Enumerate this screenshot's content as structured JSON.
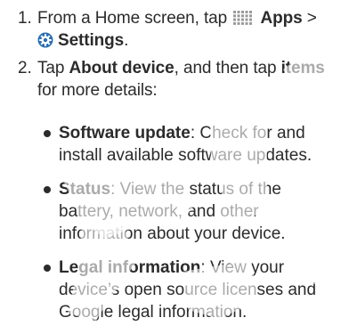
{
  "steps": [
    {
      "number": "1.",
      "line1": {
        "pre": "From a Home screen, tap",
        "bold": "Apps",
        "post": ">"
      },
      "line2": {
        "bold": "Settings",
        "post": "."
      }
    },
    {
      "number": "2.",
      "line1": {
        "pre": "Tap ",
        "bold1": "About device",
        "mid": ", and then tap ",
        "bold2": "items"
      },
      "line2": "for more details:"
    }
  ],
  "bullets": [
    {
      "title": "Software update",
      "lines": [
        ": Check for and",
        "install available software updates."
      ]
    },
    {
      "title": "Status",
      "lines": [
        ": View the status of the",
        "battery, network, and other",
        "information about your device."
      ]
    },
    {
      "title": "Legal information",
      "lines": [
        ": View your",
        "device’s open source licenses and",
        "Google legal information."
      ]
    }
  ],
  "colors": {
    "text": "#2b2b2b",
    "settings_icon": "#2a6fb3"
  },
  "icons": {
    "apps": "apps-grid-icon",
    "settings": "settings-gear-icon"
  }
}
